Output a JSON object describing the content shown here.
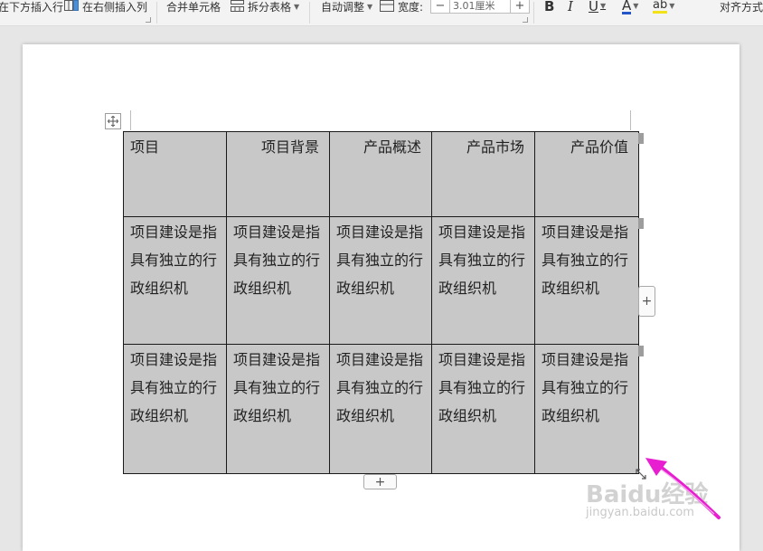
{
  "toolbar": {
    "insert_below": "在下方插入行",
    "insert_right": "在右侧插入列",
    "merge_cells": "合并单元格",
    "split_table": "拆分表格",
    "auto_adjust": "自动调整",
    "width_label": "宽度:",
    "width_value": "3.01厘米",
    "bold": "B",
    "italic": "I",
    "underline": "U",
    "font_color": "A",
    "highlight": "ab",
    "align": "对齐方式"
  },
  "table": {
    "header": [
      "项目",
      "项目背景",
      "产品概述",
      "产品市场",
      "产品价值"
    ],
    "rows": [
      [
        "项目建设是指具有独立的行政组织机",
        "项目建设是指具有独立的行政组织机",
        "项目建设是指具有独立的行政组织机",
        "项目建设是指具有独立的行政组织机",
        "项目建设是指具有独立的行政组织机"
      ],
      [
        "项目建设是指具有独立的行政组织机",
        "项目建设是指具有独立的行政组织机",
        "项目建设是指具有独立的行政组织机",
        "项目建设是指具有独立的行政组织机",
        "项目建设是指具有独立的行政组织机"
      ]
    ]
  },
  "controls": {
    "add_column": "+",
    "add_row": "+"
  },
  "watermark": {
    "brand": "Baidu经验",
    "site": "jingyan.baidu.com"
  },
  "colors": {
    "cell_fill": "#c8c8c8",
    "annotation_arrow": "#e81fd0"
  }
}
